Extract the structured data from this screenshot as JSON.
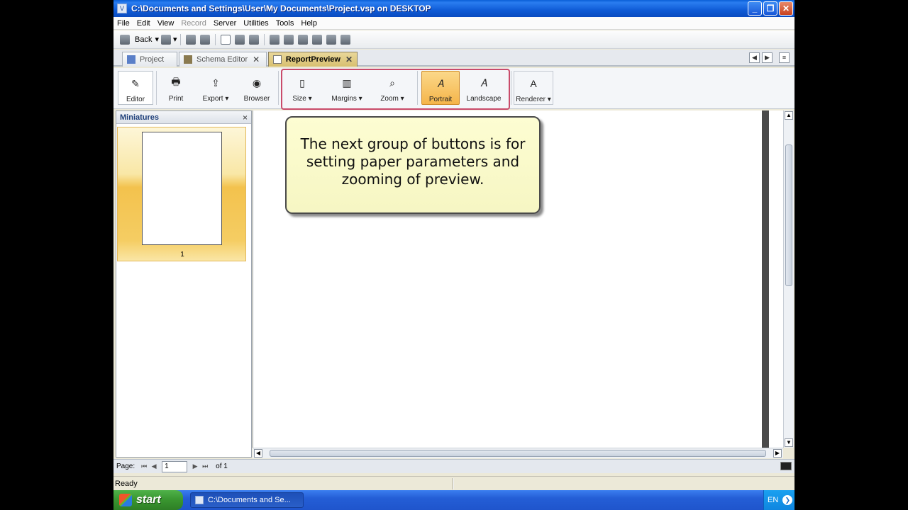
{
  "window": {
    "title": "C:\\Documents and Settings\\User\\My Documents\\Project.vsp on DESKTOP",
    "minimize": "_",
    "maximize": "❐",
    "close": "✕"
  },
  "menu": [
    "File",
    "Edit",
    "View",
    "Record",
    "Server",
    "Utilities",
    "Tools",
    "Help"
  ],
  "toolbar": {
    "back_label": "Back"
  },
  "tabs": [
    {
      "label": "Project",
      "active": false
    },
    {
      "label": "Schema Editor",
      "active": false
    },
    {
      "label": "ReportPreview",
      "active": true
    }
  ],
  "ribbon": {
    "editor": "Editor",
    "print": "Print",
    "export": "Export ▾",
    "browser": "Browser",
    "size": "Size ▾",
    "margins": "Margins ▾",
    "zoom": "Zoom ▾",
    "portrait": "Portrait",
    "landscape": "Landscape",
    "renderer": "Renderer ▾",
    "selected_orientation": "Portrait"
  },
  "miniatures": {
    "title": "Miniatures",
    "close": "×",
    "page_number": "1"
  },
  "callout": {
    "text": "The next group of buttons is for setting paper parameters and zooming of preview."
  },
  "pagebar": {
    "label": "Page:",
    "current_page": "1",
    "of_label": "of 1"
  },
  "status": {
    "text": "Ready"
  },
  "taskbar": {
    "start_label": "start",
    "task_item": "C:\\Documents and Se...",
    "language": "EN"
  },
  "colors": {
    "titlebar": "#0f5bd6",
    "highlight_box": "#c94b6a",
    "callout_bg": "#fdfdd2",
    "portrait_pressed": "#f5b54a"
  }
}
